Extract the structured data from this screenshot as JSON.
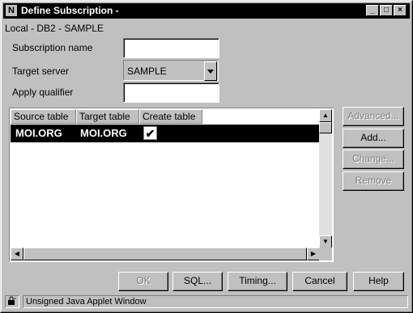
{
  "window": {
    "title": "Define Subscription -",
    "app_icon": "N",
    "minimize_glyph": "_",
    "maximize_glyph": "□",
    "close_glyph": "×"
  },
  "context_line": "Local  - DB2 - SAMPLE",
  "form": {
    "subscription_name_label": "Subscription name",
    "subscription_name_value": "",
    "target_server_label": "Target server",
    "target_server_value": "SAMPLE",
    "apply_qualifier_label": "Apply qualifier",
    "apply_qualifier_value": ""
  },
  "table": {
    "columns": [
      "Source table",
      "Target table",
      "Create table"
    ],
    "rows": [
      {
        "source": "MOI.ORG",
        "target": "MOI.ORG",
        "create": "✔"
      }
    ]
  },
  "side_buttons": {
    "advanced": "Advanced...",
    "add": "Add...",
    "change": "Change...",
    "remove": "Remove"
  },
  "bottom_buttons": {
    "ok": "OK",
    "sql": "SQL...",
    "timing": "Timing...",
    "cancel": "Cancel",
    "help": "Help"
  },
  "status": {
    "text": "Unsigned Java Applet Window",
    "icon": "lock-icon"
  }
}
